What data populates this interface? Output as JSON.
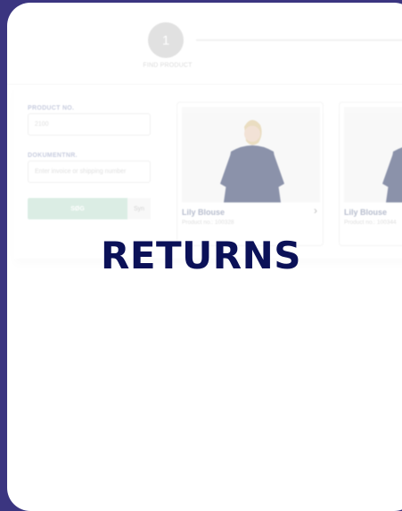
{
  "stepper": {
    "step_number": "1",
    "step_label": "FIND PRODUCT"
  },
  "form": {
    "product_no_label": "PRODUCT NO.",
    "product_no_value": "2100",
    "document_label": "DOKUMENTNR.",
    "document_placeholder": "Enter invoice or shipping number",
    "search_label": "SØG",
    "sync_label": "Syn"
  },
  "products": [
    {
      "name": "Lily Blouse",
      "sub": "Product no.: 100328"
    },
    {
      "name": "Lily Blouse",
      "sub": "Product no.: 100344"
    }
  ],
  "overlay": {
    "title": "RETURNS"
  },
  "colors": {
    "background": "#3b3580",
    "title": "#0b1158",
    "search_button": "#bfe0cf"
  }
}
